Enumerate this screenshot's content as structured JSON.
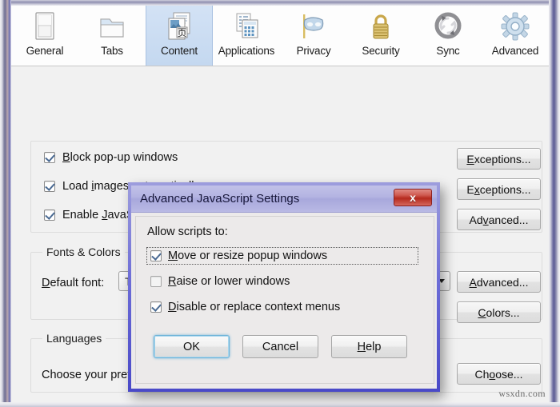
{
  "window": {
    "watermark": "wsxdn.com"
  },
  "toolbar": {
    "items": [
      {
        "label": "General",
        "icon": "window-page-icon",
        "selected": false
      },
      {
        "label": "Tabs",
        "icon": "folder-tab-icon",
        "selected": false
      },
      {
        "label": "Content",
        "icon": "content-pages-icon",
        "selected": true
      },
      {
        "label": "Applications",
        "icon": "applications-icon",
        "selected": false
      },
      {
        "label": "Privacy",
        "icon": "mask-icon",
        "selected": false
      },
      {
        "label": "Security",
        "icon": "padlock-icon",
        "selected": false
      },
      {
        "label": "Sync",
        "icon": "sync-arrows-icon",
        "selected": false
      },
      {
        "label": "Advanced",
        "icon": "gear-icon",
        "selected": false
      }
    ]
  },
  "content_panel": {
    "checkboxes": [
      {
        "label_pre": "",
        "label_key": "B",
        "label_post": "lock pop-up windows",
        "checked": true
      },
      {
        "label_pre": "Load ",
        "label_key": "i",
        "label_post": "mages automatically",
        "checked": true
      },
      {
        "label_pre": "Enable ",
        "label_key": "J",
        "label_post": "avaScript",
        "checked": true
      }
    ],
    "buttons": [
      {
        "pre": "",
        "key": "E",
        "post": "xceptions..."
      },
      {
        "pre": "E",
        "key": "x",
        "post": "ceptions..."
      },
      {
        "pre": "Ad",
        "key": "v",
        "post": "anced..."
      }
    ]
  },
  "fonts_group": {
    "legend": "Fonts & Colors",
    "default_font_label_pre": "",
    "default_font_label_key": "D",
    "default_font_label_post": "efault font:",
    "default_font_value": "Ti",
    "buttons": [
      {
        "pre": "",
        "key": "A",
        "post": "dvanced..."
      },
      {
        "pre": "",
        "key": "C",
        "post": "olors..."
      }
    ]
  },
  "languages_group": {
    "legend": "Languages",
    "description": "Choose your pref",
    "button": {
      "pre": "Ch",
      "key": "o",
      "post": "ose..."
    }
  },
  "dialog": {
    "title": "Advanced JavaScript Settings",
    "close_label": "x",
    "allow_label": "Allow scripts to:",
    "checkboxes": [
      {
        "pre": "",
        "key": "M",
        "post": "ove or resize popup windows",
        "checked": true,
        "focused": true
      },
      {
        "pre": "",
        "key": "R",
        "post": "aise or lower windows",
        "checked": false,
        "focused": false
      },
      {
        "pre": "",
        "key": "D",
        "post": "isable or replace context menus",
        "checked": true,
        "focused": false
      }
    ],
    "buttons": [
      {
        "pre": "OK",
        "key": "",
        "post": "",
        "default": true
      },
      {
        "pre": "Cancel",
        "key": "",
        "post": "",
        "default": false
      },
      {
        "pre": "",
        "key": "H",
        "post": "elp",
        "default": false
      }
    ]
  },
  "colors": {
    "selected_tab_bg": "#c8dcf2",
    "dialog_border": "#5a5ad0",
    "dialog_title_bg": "#b4b4e2",
    "close_button": "#b52a1e",
    "default_button_outline": "#6fb4d8"
  }
}
